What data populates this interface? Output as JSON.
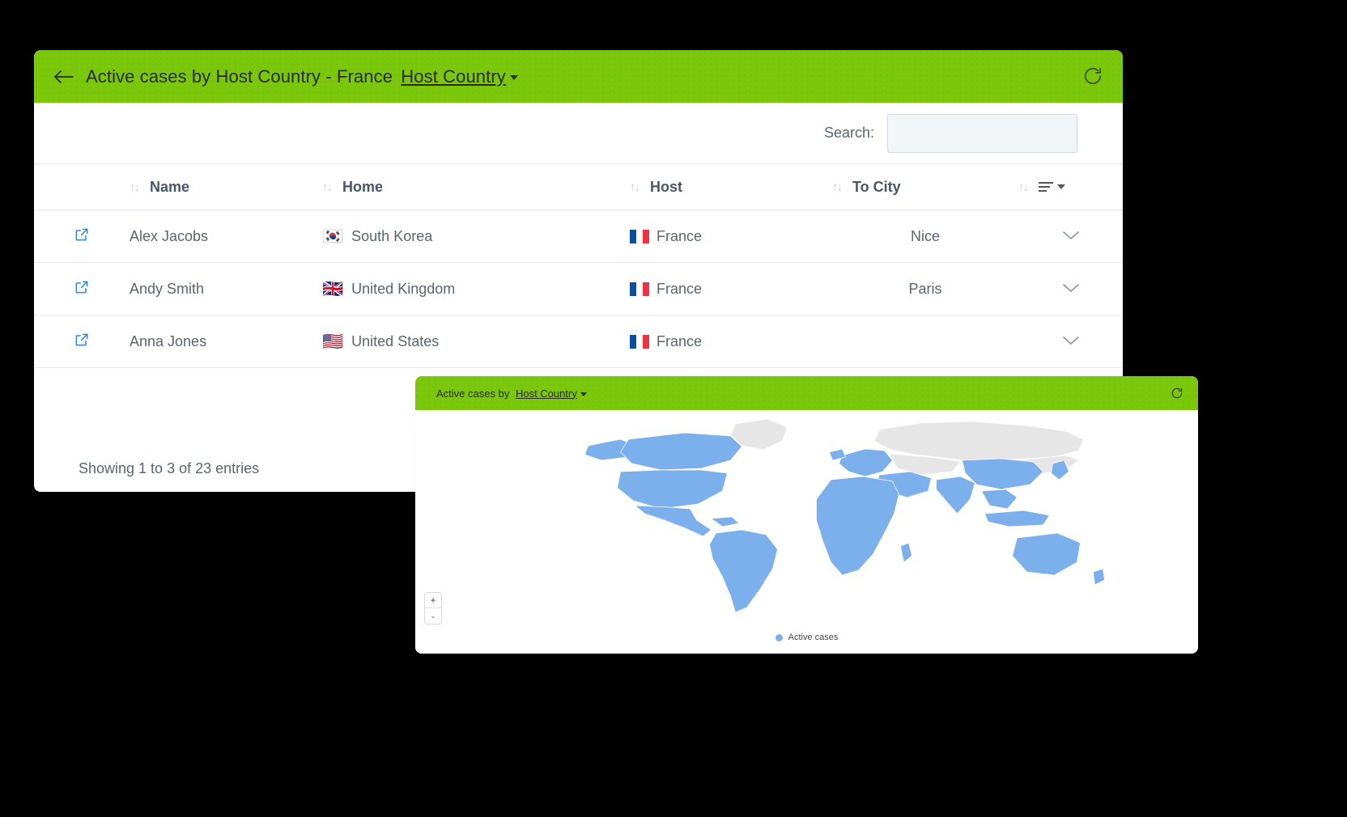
{
  "table_panel": {
    "header": {
      "back_icon": "arrow-left-icon",
      "title_text": "Active cases by Host Country - France",
      "title_link": "Host Country",
      "refresh_icon": "refresh-icon"
    },
    "search": {
      "label": "Search:",
      "value": "",
      "placeholder": ""
    },
    "columns": [
      {
        "key": "icon",
        "label": ""
      },
      {
        "key": "name",
        "label": "Name"
      },
      {
        "key": "home",
        "label": "Home"
      },
      {
        "key": "host",
        "label": "Host"
      },
      {
        "key": "city",
        "label": "To City"
      },
      {
        "key": "tools",
        "label": ""
      }
    ],
    "rows": [
      {
        "open_icon": "external-link-icon",
        "name": "Alex Jacobs",
        "home_flag": "🇰🇷",
        "home": "South Korea",
        "host_flag": "france",
        "host": "France",
        "city": "Nice",
        "expand_icon": "chevron-down-icon"
      },
      {
        "open_icon": "external-link-icon",
        "name": "Andy Smith",
        "home_flag": "🇬🇧",
        "home": "United Kingdom",
        "host_flag": "france",
        "host": "France",
        "city": "Paris",
        "expand_icon": "chevron-down-icon"
      },
      {
        "open_icon": "external-link-icon",
        "name": "Anna Jones",
        "home_flag": "🇺🇸",
        "home": "United States",
        "host_flag": "france",
        "host": "France",
        "city": "",
        "expand_icon": "chevron-down-icon"
      }
    ],
    "footer": "Showing 1 to 3 of 23 entries"
  },
  "map_panel": {
    "header": {
      "title_text": "Active cases by",
      "title_link": "Host Country",
      "refresh_icon": "refresh-icon"
    },
    "zoom_in": "+",
    "zoom_out": "-",
    "legend": "Active cases"
  },
  "colors": {
    "header_green": "#7ac70c",
    "map_active": "#7cb0ec",
    "map_inactive": "#e6e6e6",
    "link_blue": "#2e86de"
  },
  "chart_data": {
    "type": "heatmap",
    "title": "Active cases by Host Country",
    "legend": [
      "Active cases"
    ],
    "legend_position": "bottom-center",
    "regions_highlighted": [
      "North America",
      "South America",
      "Africa",
      "Europe (west)",
      "Middle East",
      "South Asia",
      "Southeast Asia",
      "Australia"
    ],
    "regions_inactive": [
      "Russia",
      "Greenland",
      "Central Asia"
    ],
    "colors": {
      "active": "#7cb0ec",
      "inactive": "#e6e6e6"
    }
  }
}
